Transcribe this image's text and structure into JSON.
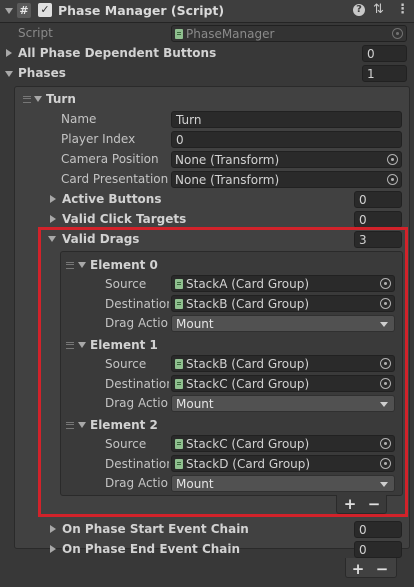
{
  "component": {
    "title": "Phase Manager (Script)",
    "script_label": "Script",
    "script_value": "PhaseManager"
  },
  "fields": {
    "all_buttons_label": "All Phase Dependent Buttons",
    "all_buttons_value": "0",
    "phases_label": "Phases",
    "phases_value": "1"
  },
  "turn": {
    "title": "Turn",
    "name_label": "Name",
    "name_value": "Turn",
    "player_index_label": "Player Index",
    "player_index_value": "0",
    "camera_label": "Camera Position",
    "camera_value": "None (Transform)",
    "card_pres_label": "Card Presentation I",
    "card_pres_value": "None (Transform)",
    "active_buttons_label": "Active Buttons",
    "active_buttons_value": "0",
    "valid_click_label": "Valid Click Targets",
    "valid_click_value": "0",
    "valid_drags_label": "Valid Drags",
    "valid_drags_value": "3",
    "on_start_label": "On Phase Start Event Chain",
    "on_start_value": "0",
    "on_end_label": "On Phase End Event Chain",
    "on_end_value": "0"
  },
  "elements": [
    {
      "title": "Element 0",
      "source_label": "Source",
      "source": "StackA (Card Group)",
      "dest_label": "Destination",
      "dest": "StackB (Card Group)",
      "action_label": "Drag Actio",
      "action": "Mount"
    },
    {
      "title": "Element 1",
      "source_label": "Source",
      "source": "StackB (Card Group)",
      "dest_label": "Destination",
      "dest": "StackC (Card Group)",
      "action_label": "Drag Actio",
      "action": "Mount"
    },
    {
      "title": "Element 2",
      "source_label": "Source",
      "source": "StackC (Card Group)",
      "dest_label": "Destination",
      "dest": "StackD (Card Group)",
      "action_label": "Drag Actio",
      "action": "Mount"
    }
  ],
  "buttons": {
    "plus": "+",
    "minus": "−"
  },
  "colors": {
    "highlight": "#d2222a",
    "panel": "#383838",
    "field": "#2a2a2a"
  }
}
